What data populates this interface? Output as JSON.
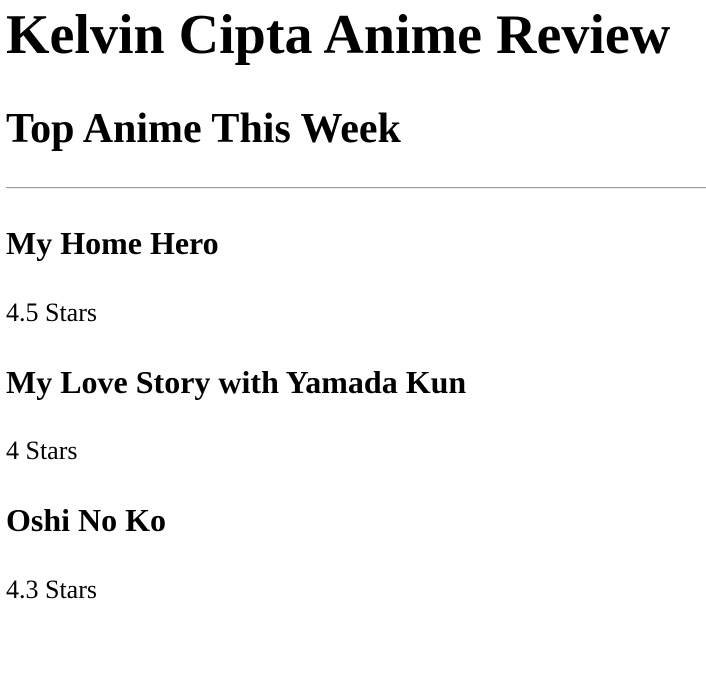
{
  "header": {
    "site_title": "Kelvin Cipta Anime Review",
    "section_title": "Top Anime This Week"
  },
  "anime": [
    {
      "name": "My Home Hero",
      "rating": "4.5 Stars"
    },
    {
      "name": "My Love Story with Yamada Kun",
      "rating": "4 Stars"
    },
    {
      "name": "Oshi No Ko",
      "rating": "4.3 Stars"
    }
  ]
}
